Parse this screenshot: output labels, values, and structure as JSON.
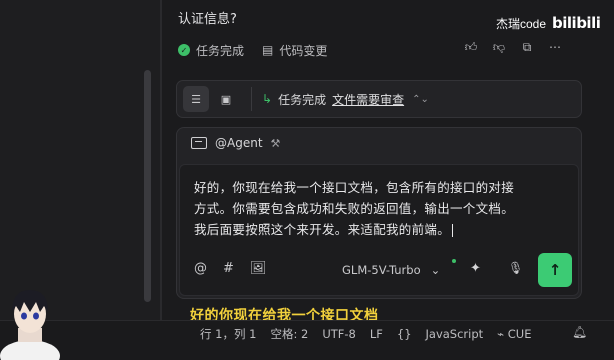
{
  "chat": {
    "question_tail": "认证信息?",
    "status": {
      "task_done": "任务完成",
      "code_changes": "代码变更"
    },
    "watermark": {
      "text": "杰瑞code",
      "logo": "bilibili"
    }
  },
  "task_bar": {
    "status_label": "任务完成",
    "review_link": "文件需要审查"
  },
  "composer": {
    "agent_label": "@Agent",
    "text_lines": [
      "好的，你现在给我一个接口文档，包含所有的接口的对接",
      "方式。你需要包含成功和失败的返回值，输出一个文档。",
      "我后面要按照这个来开发。来适配我的前端。"
    ],
    "model": "GLM-5V-Turbo"
  },
  "subtitle": "好的你现在给我一个接口文档",
  "statusbar": {
    "position": "行 1，列 1",
    "spaces": "空格: 2",
    "encoding": "UTF-8",
    "eol": "LF",
    "braces": "{}",
    "language": "JavaScript",
    "cue": "CUE"
  },
  "colors": {
    "accent_green": "#3ccb74",
    "subtitle_yellow": "#f2d13c"
  }
}
